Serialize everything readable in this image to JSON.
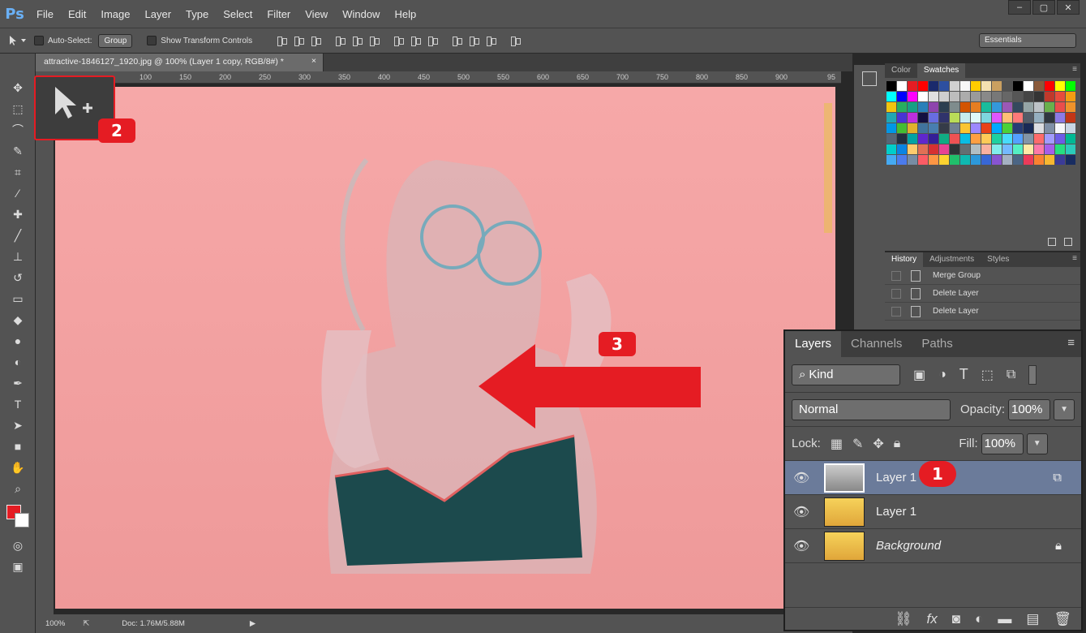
{
  "app": {
    "logo": "Ps",
    "menu": [
      "File",
      "Edit",
      "Image",
      "Layer",
      "Type",
      "Select",
      "Filter",
      "View",
      "Window",
      "Help"
    ],
    "window_controls": [
      "–",
      "▢",
      "✕"
    ]
  },
  "options_bar": {
    "auto_select_label": "Auto-Select:",
    "auto_select_value": "Group",
    "show_transform_label": "Show Transform Controls",
    "workspace": "Essentials"
  },
  "document": {
    "tab_title": "attractive-1846127_1920.jpg @ 100% (Layer 1 copy, RGB/8#) *",
    "tab_close": "×",
    "ruler_ticks": [
      "100",
      "150",
      "200",
      "250",
      "300",
      "350",
      "400",
      "450",
      "500",
      "550",
      "600",
      "650",
      "700",
      "750",
      "800",
      "850",
      "900",
      "95"
    ]
  },
  "status": {
    "zoom": "100%",
    "doc_info": "Doc: 1.76M/5.88M"
  },
  "callouts": {
    "one": "1",
    "two": "2",
    "three": "3"
  },
  "swatches_panel": {
    "tabs": [
      "Color",
      "Swatches"
    ],
    "active": "Swatches",
    "colors": [
      "#000000",
      "#ffffff",
      "#e51c23",
      "#ff0000",
      "#1a2a6c",
      "#2d4fa0",
      "#d0d0d0",
      "#f7f7f7",
      "#ffcc00",
      "#f4e0b0",
      "#caa060",
      "#505050",
      "#000000",
      "#ffffff",
      "#8a5a3a",
      "#ff0000",
      "#ffff00",
      "#00ff00",
      "#00ffff",
      "#0000ff",
      "#ff00ff",
      "#ffffff",
      "#e0e0e0",
      "#cfcfcf",
      "#bdbdbd",
      "#acacac",
      "#9a9a9a",
      "#898989",
      "#787878",
      "#676767",
      "#565656",
      "#454545",
      "#343434"
    ]
  },
  "history_panel": {
    "tabs": [
      "History",
      "Adjustments",
      "Styles"
    ],
    "items": [
      "Merge Group",
      "Delete Layer",
      "Delete Layer"
    ]
  },
  "layers_panel": {
    "tabs": [
      "Layers",
      "Channels",
      "Paths"
    ],
    "kind": "Kind",
    "blend_mode": "Normal",
    "opacity_label": "Opacity:",
    "opacity": "100%",
    "lock_label": "Lock:",
    "fill_label": "Fill:",
    "fill": "100%",
    "layers": [
      {
        "name": "Layer 1"
      },
      {
        "name": "Layer 1"
      },
      {
        "name": "Background"
      }
    ]
  },
  "colors": {
    "accent": "#e51c23",
    "chrome": "#535353"
  }
}
